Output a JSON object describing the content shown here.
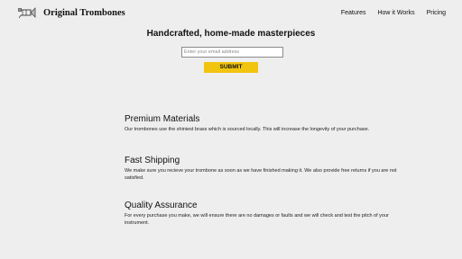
{
  "header": {
    "brand": "Original Trombones",
    "logo_icon": "trombone-icon",
    "nav": [
      {
        "label": "Features"
      },
      {
        "label": "How it Works"
      },
      {
        "label": "Pricing"
      }
    ]
  },
  "hero": {
    "title": "Handcrafted, home-made masterpieces",
    "email_placeholder": "Enter your email address",
    "submit_label": "SUBMIT",
    "submit_color": "#f1c40f"
  },
  "features": [
    {
      "title": "Premium Materials",
      "text": "Our trombones use the shiniest brass which is sourced locally. This will increase the longevity of your purchase."
    },
    {
      "title": "Fast Shipping",
      "text": "We make sure you recieve your trombone as soon as we have finished making it. We also provide free returns if you are not satisfied."
    },
    {
      "title": "Quality Assurance",
      "text": "For every purchase you make, we will ensure there are no damages or faults and we will check and test the pitch of your instrument."
    }
  ]
}
